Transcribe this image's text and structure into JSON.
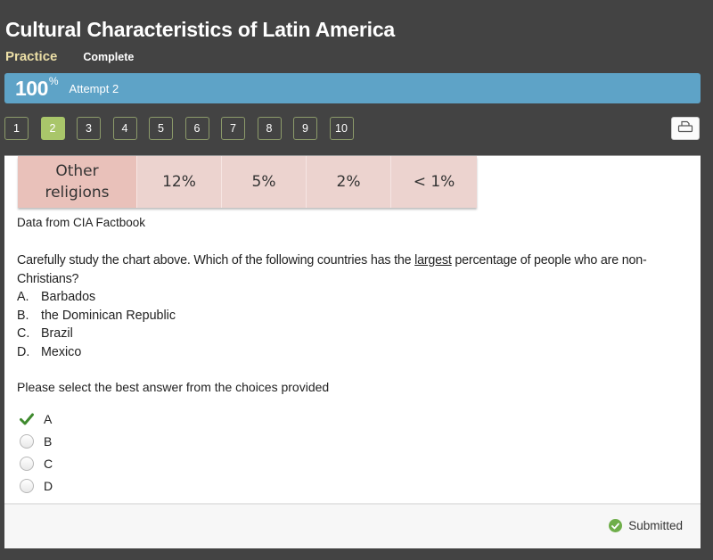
{
  "header": {
    "title": "Cultural Characteristics of Latin America",
    "mode": "Practice",
    "status": "Complete"
  },
  "score_bar": {
    "score": "100",
    "score_unit": "%",
    "attempt": "Attempt 2",
    "color": "#5ea3c7"
  },
  "question_nav": {
    "items": [
      "1",
      "2",
      "3",
      "4",
      "5",
      "6",
      "7",
      "8",
      "9",
      "10"
    ],
    "active_index": 1,
    "active_color": "#a9c66a"
  },
  "toolbar": {
    "print_icon": "printer-icon"
  },
  "table": {
    "row_header": [
      "Other",
      "religions"
    ],
    "values": [
      "12%",
      "5%",
      "2%",
      "< 1%"
    ]
  },
  "source": "Data from CIA Factbook",
  "question": {
    "text_before": "Carefully study the chart above. Which of the following countries has the ",
    "emphasis": "largest",
    "text_after": " percentage of people who are non-Christians?",
    "options": [
      {
        "letter": "A.",
        "text": "Barbados"
      },
      {
        "letter": "B.",
        "text": "the Dominican Republic"
      },
      {
        "letter": "C.",
        "text": "Brazil"
      },
      {
        "letter": "D.",
        "text": "Mexico"
      }
    ]
  },
  "instruction": "Please select the best answer from the choices provided",
  "choices": [
    {
      "label": "A",
      "state": "correct-selected"
    },
    {
      "label": "B",
      "state": "unselected"
    },
    {
      "label": "C",
      "state": "unselected"
    },
    {
      "label": "D",
      "state": "unselected"
    }
  ],
  "footer": {
    "status": "Submitted",
    "status_color": "#6fae4a"
  }
}
